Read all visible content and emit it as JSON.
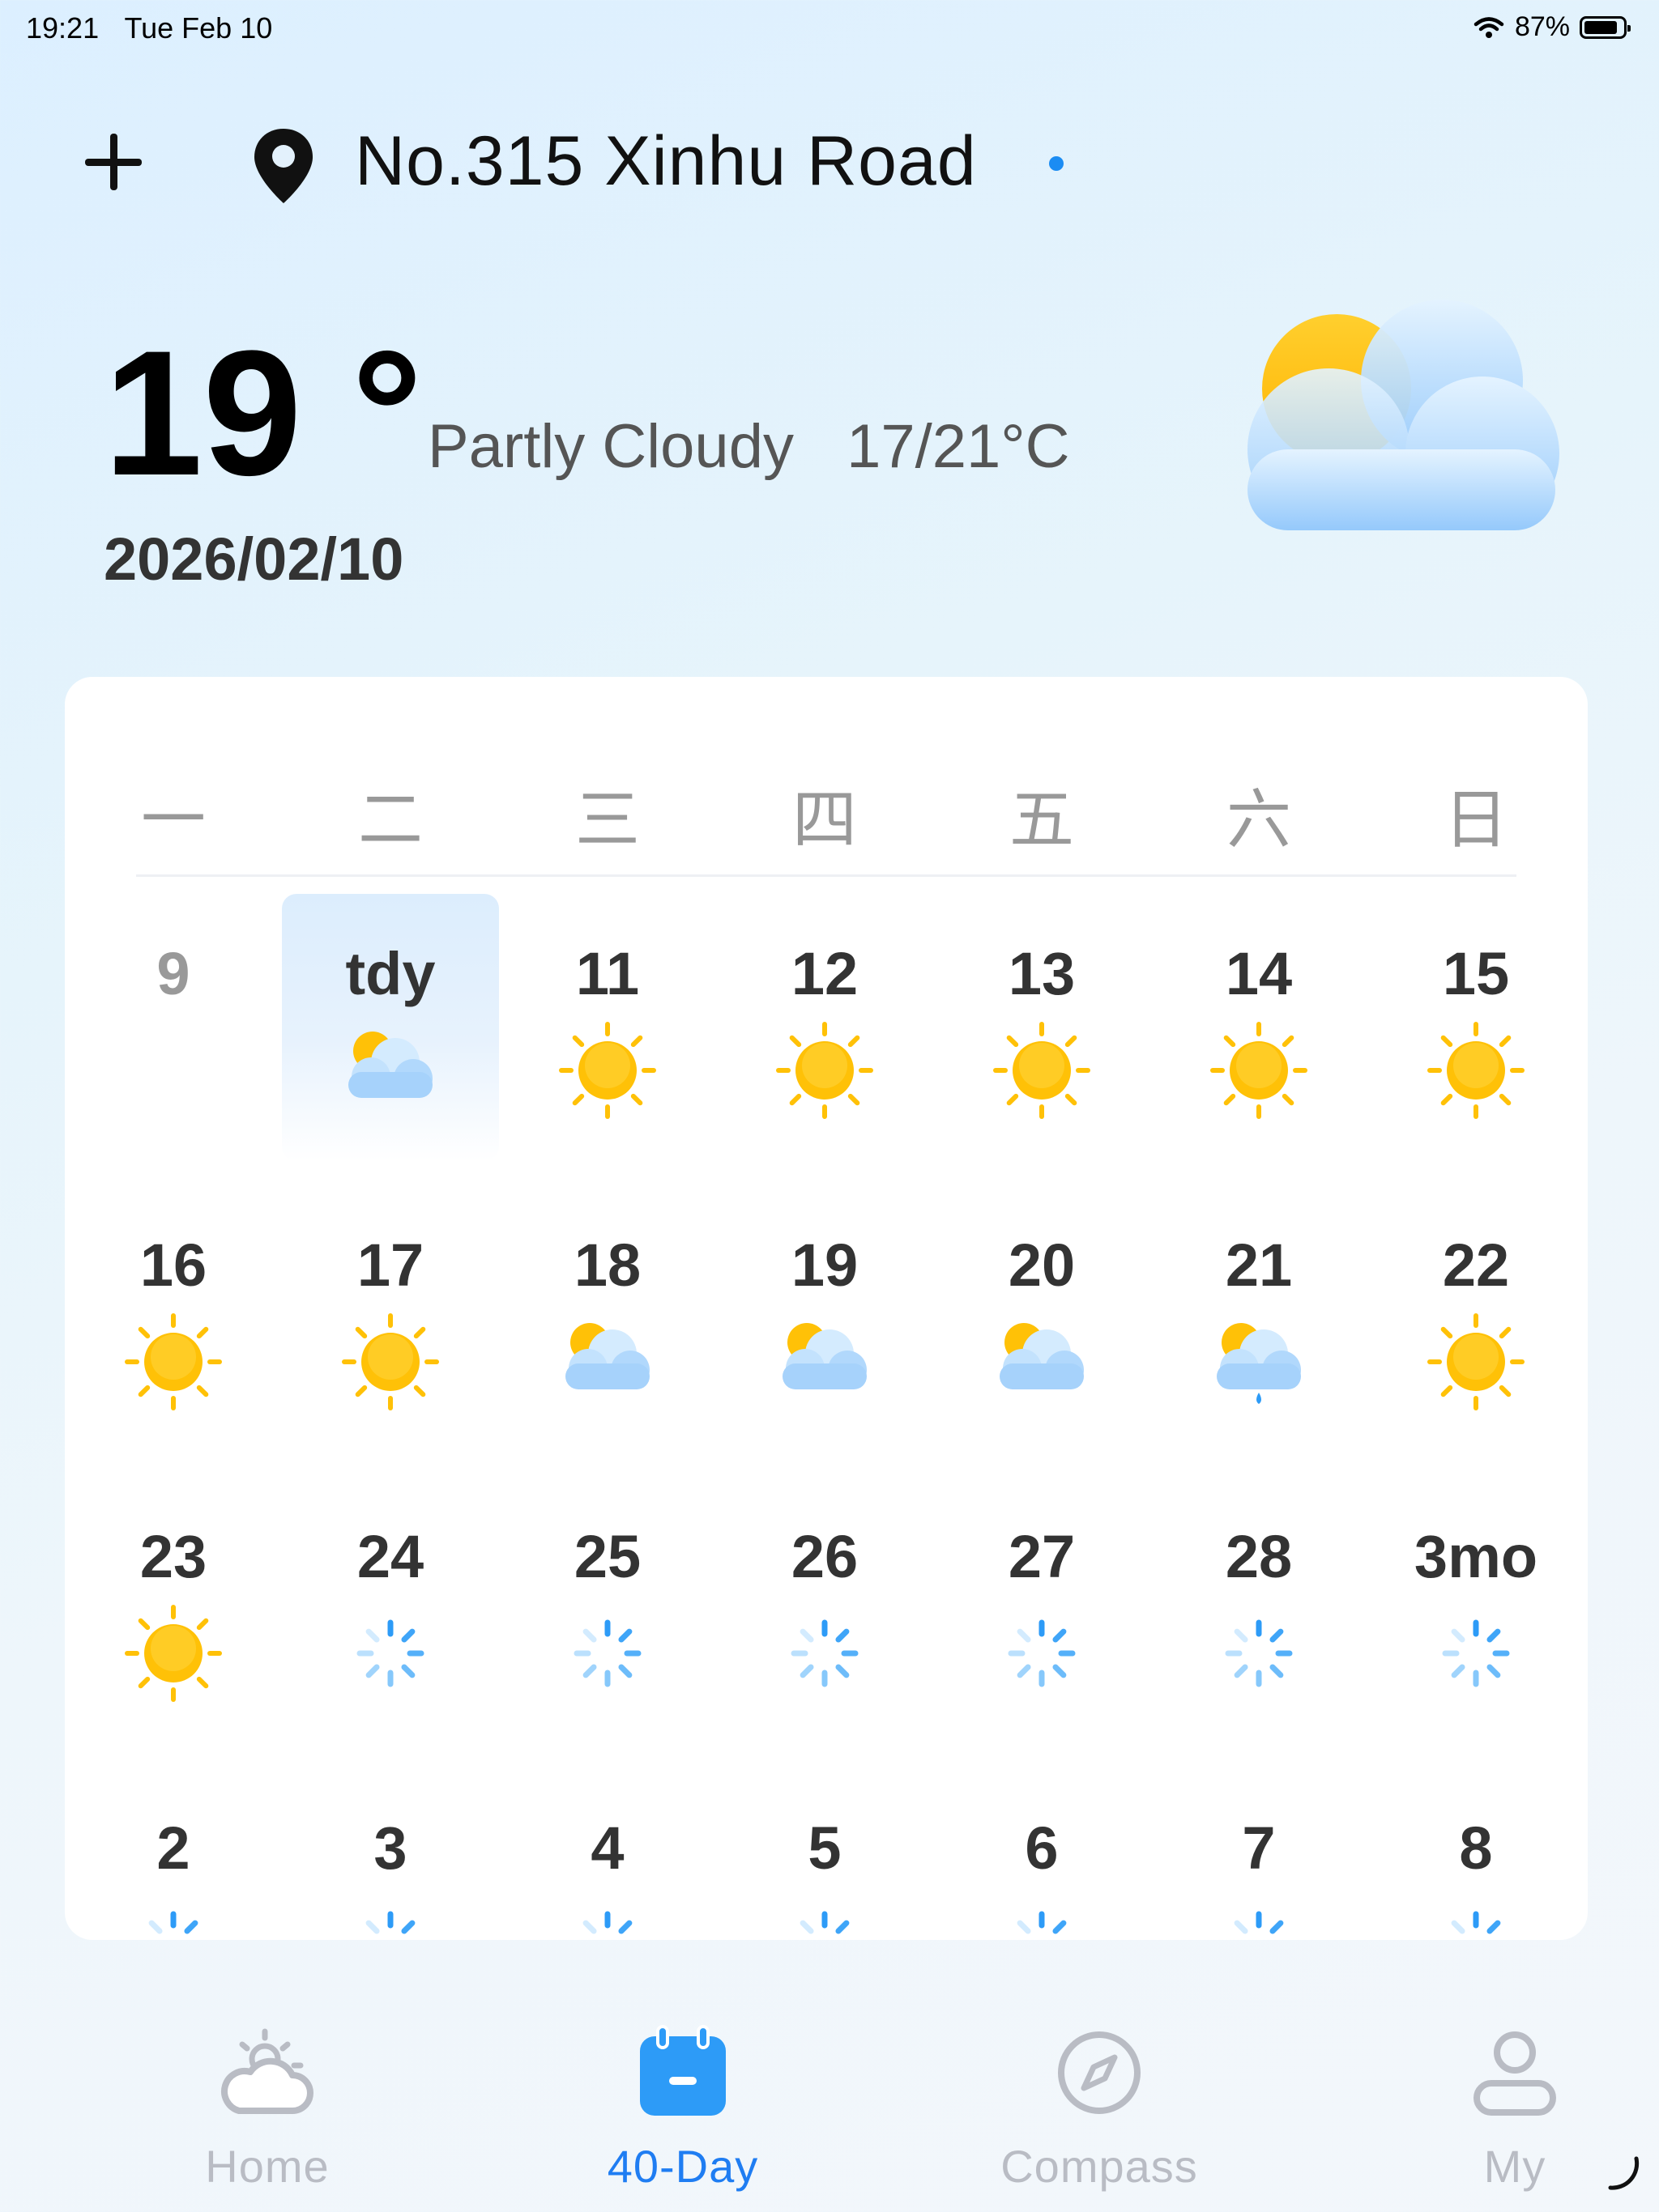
{
  "status_bar": {
    "time": "19:21",
    "date": "Tue Feb 10",
    "battery": "87%"
  },
  "header": {
    "location": "No.315 Xinhu Road"
  },
  "current": {
    "temp": "19 °",
    "condition": "Partly Cloudy",
    "range": "17/21°C",
    "date": "2026/02/10",
    "icon": "partly-cloudy-icon"
  },
  "calendar": {
    "weekdays": [
      "一",
      "二",
      "三",
      "四",
      "五",
      "六",
      "日"
    ],
    "rows": [
      [
        {
          "label": "9",
          "icon": "none",
          "past": true
        },
        {
          "label": "tdy",
          "icon": "partly-cloudy",
          "today": true
        },
        {
          "label": "11",
          "icon": "sunny"
        },
        {
          "label": "12",
          "icon": "sunny"
        },
        {
          "label": "13",
          "icon": "sunny"
        },
        {
          "label": "14",
          "icon": "sunny"
        },
        {
          "label": "15",
          "icon": "sunny"
        }
      ],
      [
        {
          "label": "16",
          "icon": "sunny"
        },
        {
          "label": "17",
          "icon": "sunny"
        },
        {
          "label": "18",
          "icon": "partly-cloudy"
        },
        {
          "label": "19",
          "icon": "partly-cloudy"
        },
        {
          "label": "20",
          "icon": "partly-cloudy"
        },
        {
          "label": "21",
          "icon": "light-rain"
        },
        {
          "label": "22",
          "icon": "sunny"
        }
      ],
      [
        {
          "label": "23",
          "icon": "sunny"
        },
        {
          "label": "24",
          "icon": "loading"
        },
        {
          "label": "25",
          "icon": "loading"
        },
        {
          "label": "26",
          "icon": "loading"
        },
        {
          "label": "27",
          "icon": "loading"
        },
        {
          "label": "28",
          "icon": "loading"
        },
        {
          "label": "3mo",
          "icon": "loading"
        }
      ],
      [
        {
          "label": "2",
          "icon": "loading"
        },
        {
          "label": "3",
          "icon": "loading"
        },
        {
          "label": "4",
          "icon": "loading"
        },
        {
          "label": "5",
          "icon": "loading"
        },
        {
          "label": "6",
          "icon": "loading"
        },
        {
          "label": "7",
          "icon": "loading"
        },
        {
          "label": "8",
          "icon": "loading"
        }
      ]
    ]
  },
  "tabs": [
    {
      "label": "Home",
      "icon": "home-weather-icon",
      "active": false
    },
    {
      "label": "40-Day",
      "icon": "calendar-icon",
      "active": true
    },
    {
      "label": "Compass",
      "icon": "compass-icon",
      "active": false
    },
    {
      "label": "My",
      "icon": "person-icon",
      "active": false
    }
  ],
  "colors": {
    "accent": "#1f7df2",
    "sun": "#ffc107",
    "cloud": "#9fd0fb",
    "inactive": "#b9bcc4"
  }
}
